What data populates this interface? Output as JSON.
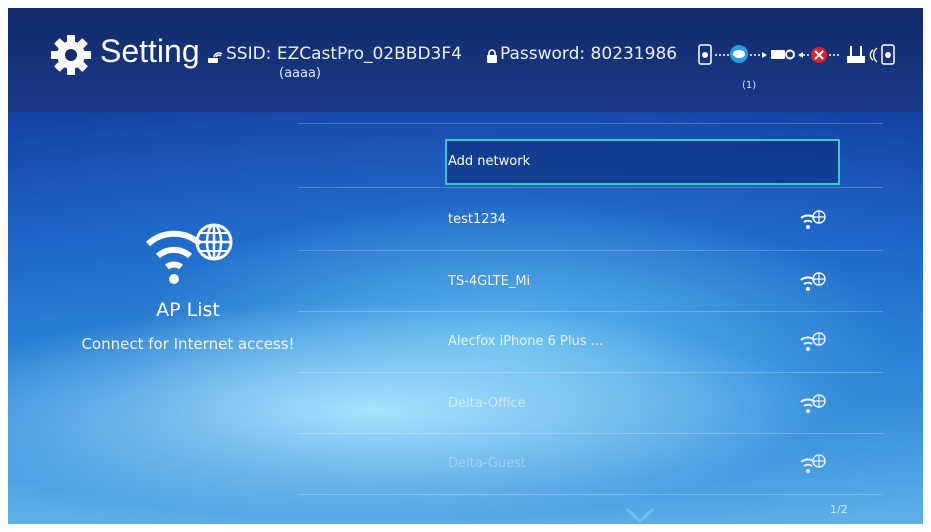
{
  "header": {
    "title": "Setting",
    "ssid_label": "SSID:",
    "ssid_value": "EZCastPro_02BBD3F4",
    "ssid_sub": "(aaaa)",
    "password_label": "Password:",
    "password_value": "80231986",
    "connected_count": "(1)",
    "icons": [
      "gear-icon",
      "hotspot-icon",
      "lock-icon",
      "phone-icon",
      "ezcast-icon",
      "projector-icon",
      "error-icon",
      "router-icon"
    ]
  },
  "left_panel": {
    "icon": "wifi-globe-icon",
    "title": "AP List",
    "subtitle": "Connect for Internet access!"
  },
  "networks": [
    {
      "label": "Add network",
      "selected": true
    },
    {
      "label": "test1234",
      "icon": "wifi-globe-icon"
    },
    {
      "label": "TS-4GLTE_Mi",
      "icon": "wifi-globe-icon"
    },
    {
      "label": "Alecfox iPhone 6 Plus ...",
      "icon": "wifi-globe-icon"
    },
    {
      "label": "Delta-Office",
      "icon": "wifi-globe-icon"
    },
    {
      "label": "Delta-Guest",
      "icon": "wifi-globe-icon"
    }
  ],
  "footer": {
    "more_icon": "chevron-down-icon",
    "page_indicator": "1/2"
  },
  "colors": {
    "focus_border": "#3fc3cf",
    "error_badge": "#e0202a",
    "header_bg": "#132a6c"
  }
}
